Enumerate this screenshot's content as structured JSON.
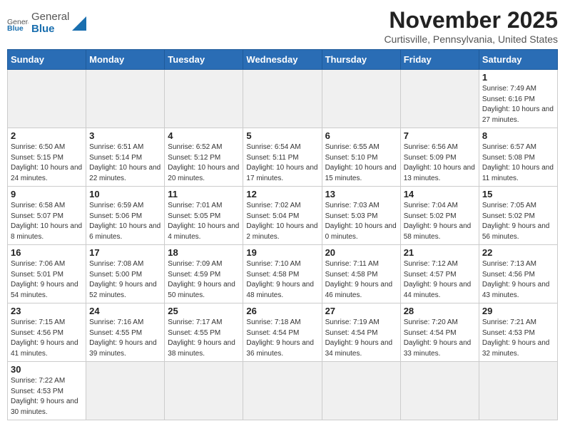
{
  "header": {
    "logo_general": "General",
    "logo_blue": "Blue",
    "title": "November 2025",
    "subtitle": "Curtisville, Pennsylvania, United States"
  },
  "columns": [
    "Sunday",
    "Monday",
    "Tuesday",
    "Wednesday",
    "Thursday",
    "Friday",
    "Saturday"
  ],
  "weeks": [
    [
      {
        "day": "",
        "info": "",
        "empty": true
      },
      {
        "day": "",
        "info": "",
        "empty": true
      },
      {
        "day": "",
        "info": "",
        "empty": true
      },
      {
        "day": "",
        "info": "",
        "empty": true
      },
      {
        "day": "",
        "info": "",
        "empty": true
      },
      {
        "day": "",
        "info": "",
        "empty": true
      },
      {
        "day": "1",
        "info": "Sunrise: 7:49 AM\nSunset: 6:16 PM\nDaylight: 10 hours and 27 minutes."
      }
    ],
    [
      {
        "day": "2",
        "info": "Sunrise: 6:50 AM\nSunset: 5:15 PM\nDaylight: 10 hours and 24 minutes."
      },
      {
        "day": "3",
        "info": "Sunrise: 6:51 AM\nSunset: 5:14 PM\nDaylight: 10 hours and 22 minutes."
      },
      {
        "day": "4",
        "info": "Sunrise: 6:52 AM\nSunset: 5:12 PM\nDaylight: 10 hours and 20 minutes."
      },
      {
        "day": "5",
        "info": "Sunrise: 6:54 AM\nSunset: 5:11 PM\nDaylight: 10 hours and 17 minutes."
      },
      {
        "day": "6",
        "info": "Sunrise: 6:55 AM\nSunset: 5:10 PM\nDaylight: 10 hours and 15 minutes."
      },
      {
        "day": "7",
        "info": "Sunrise: 6:56 AM\nSunset: 5:09 PM\nDaylight: 10 hours and 13 minutes."
      },
      {
        "day": "8",
        "info": "Sunrise: 6:57 AM\nSunset: 5:08 PM\nDaylight: 10 hours and 11 minutes."
      }
    ],
    [
      {
        "day": "9",
        "info": "Sunrise: 6:58 AM\nSunset: 5:07 PM\nDaylight: 10 hours and 8 minutes."
      },
      {
        "day": "10",
        "info": "Sunrise: 6:59 AM\nSunset: 5:06 PM\nDaylight: 10 hours and 6 minutes."
      },
      {
        "day": "11",
        "info": "Sunrise: 7:01 AM\nSunset: 5:05 PM\nDaylight: 10 hours and 4 minutes."
      },
      {
        "day": "12",
        "info": "Sunrise: 7:02 AM\nSunset: 5:04 PM\nDaylight: 10 hours and 2 minutes."
      },
      {
        "day": "13",
        "info": "Sunrise: 7:03 AM\nSunset: 5:03 PM\nDaylight: 10 hours and 0 minutes."
      },
      {
        "day": "14",
        "info": "Sunrise: 7:04 AM\nSunset: 5:02 PM\nDaylight: 9 hours and 58 minutes."
      },
      {
        "day": "15",
        "info": "Sunrise: 7:05 AM\nSunset: 5:02 PM\nDaylight: 9 hours and 56 minutes."
      }
    ],
    [
      {
        "day": "16",
        "info": "Sunrise: 7:06 AM\nSunset: 5:01 PM\nDaylight: 9 hours and 54 minutes."
      },
      {
        "day": "17",
        "info": "Sunrise: 7:08 AM\nSunset: 5:00 PM\nDaylight: 9 hours and 52 minutes."
      },
      {
        "day": "18",
        "info": "Sunrise: 7:09 AM\nSunset: 4:59 PM\nDaylight: 9 hours and 50 minutes."
      },
      {
        "day": "19",
        "info": "Sunrise: 7:10 AM\nSunset: 4:58 PM\nDaylight: 9 hours and 48 minutes."
      },
      {
        "day": "20",
        "info": "Sunrise: 7:11 AM\nSunset: 4:58 PM\nDaylight: 9 hours and 46 minutes."
      },
      {
        "day": "21",
        "info": "Sunrise: 7:12 AM\nSunset: 4:57 PM\nDaylight: 9 hours and 44 minutes."
      },
      {
        "day": "22",
        "info": "Sunrise: 7:13 AM\nSunset: 4:56 PM\nDaylight: 9 hours and 43 minutes."
      }
    ],
    [
      {
        "day": "23",
        "info": "Sunrise: 7:15 AM\nSunset: 4:56 PM\nDaylight: 9 hours and 41 minutes."
      },
      {
        "day": "24",
        "info": "Sunrise: 7:16 AM\nSunset: 4:55 PM\nDaylight: 9 hours and 39 minutes."
      },
      {
        "day": "25",
        "info": "Sunrise: 7:17 AM\nSunset: 4:55 PM\nDaylight: 9 hours and 38 minutes."
      },
      {
        "day": "26",
        "info": "Sunrise: 7:18 AM\nSunset: 4:54 PM\nDaylight: 9 hours and 36 minutes."
      },
      {
        "day": "27",
        "info": "Sunrise: 7:19 AM\nSunset: 4:54 PM\nDaylight: 9 hours and 34 minutes."
      },
      {
        "day": "28",
        "info": "Sunrise: 7:20 AM\nSunset: 4:54 PM\nDaylight: 9 hours and 33 minutes."
      },
      {
        "day": "29",
        "info": "Sunrise: 7:21 AM\nSunset: 4:53 PM\nDaylight: 9 hours and 32 minutes."
      }
    ],
    [
      {
        "day": "30",
        "info": "Sunrise: 7:22 AM\nSunset: 4:53 PM\nDaylight: 9 hours and 30 minutes."
      },
      {
        "day": "",
        "info": "",
        "empty": true
      },
      {
        "day": "",
        "info": "",
        "empty": true
      },
      {
        "day": "",
        "info": "",
        "empty": true
      },
      {
        "day": "",
        "info": "",
        "empty": true
      },
      {
        "day": "",
        "info": "",
        "empty": true
      },
      {
        "day": "",
        "info": "",
        "empty": true
      }
    ]
  ]
}
